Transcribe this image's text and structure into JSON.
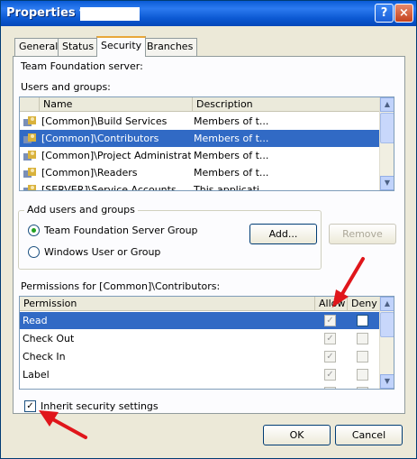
{
  "window": {
    "title": "Properties for",
    "help_glyph": "?",
    "close_glyph": "×"
  },
  "tabs": [
    {
      "label": "General"
    },
    {
      "label": "Status"
    },
    {
      "label": "Security"
    },
    {
      "label": "Branches"
    }
  ],
  "security": {
    "tfs_label": "Team Foundation server:",
    "users_label": "Users and groups:",
    "users_columns": {
      "name": "Name",
      "description": "Description"
    },
    "users": [
      {
        "name": "[Common]\\Build Services",
        "description": "Members of t..."
      },
      {
        "name": "[Common]\\Contributors",
        "description": "Members of t..."
      },
      {
        "name": "[Common]\\Project Administrators",
        "description": "Members of t..."
      },
      {
        "name": "[Common]\\Readers",
        "description": "Members of t..."
      },
      {
        "name": "[SERVER]\\Service Accounts",
        "description": "This applicati..."
      }
    ],
    "add_group": {
      "title": "Add users and groups",
      "option_tfs": "Team Foundation Server Group",
      "option_windows": "Windows User or Group",
      "add_button": "Add...",
      "remove_button": "Remove"
    },
    "perms_label": "Permissions for [Common]\\Contributors:",
    "perm_columns": {
      "permission": "Permission",
      "allow": "Allow",
      "deny": "Deny"
    },
    "permissions": [
      {
        "name": "Read"
      },
      {
        "name": "Check Out"
      },
      {
        "name": "Check In"
      },
      {
        "name": "Label"
      },
      {
        "name": "Lo"
      }
    ],
    "inherit_label": "Inherit security settings"
  },
  "footer": {
    "ok": "OK",
    "cancel": "Cancel"
  },
  "colors": {
    "selection": "#316ac5",
    "annotation_arrow": "#e0161b"
  }
}
